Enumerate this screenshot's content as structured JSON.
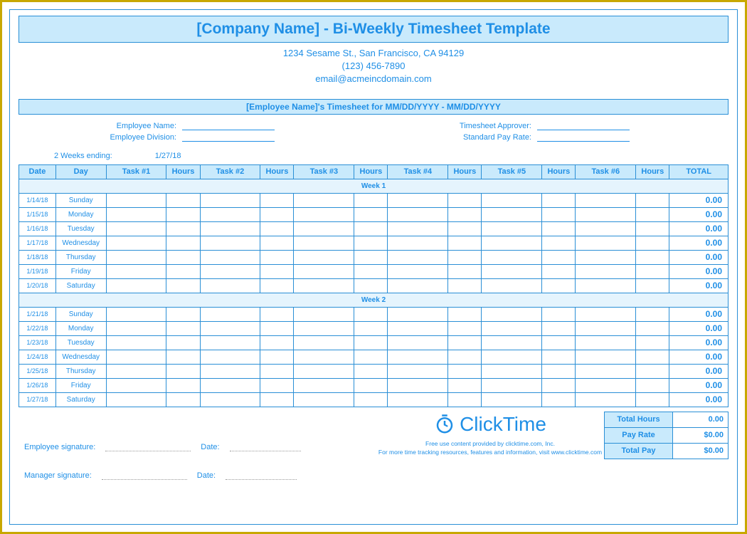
{
  "title": "[Company Name] - Bi-Weekly Timesheet Template",
  "addr": "1234 Sesame St.,   San Francisco, CA 94129",
  "phone": "(123) 456-7890",
  "email": "email@acmeincdomain.com",
  "subhdr": "[Employee Name]'s Timesheet for MM/DD/YYYY - MM/DD/YYYY",
  "labels": {
    "empName": "Employee Name:",
    "empDiv": "Employee Division:",
    "approver": "Timesheet Approver:",
    "payRate": "Standard Pay Rate:",
    "ending": "2 Weeks ending:",
    "endDate": "1/27/18",
    "empSig": "Employee signature:",
    "mgrSig": "Manager signature:",
    "date": "Date:"
  },
  "cols": [
    "Date",
    "Day",
    "Task #1",
    "Hours",
    "Task #2",
    "Hours",
    "Task #3",
    "Hours",
    "Task #4",
    "Hours",
    "Task #5",
    "Hours",
    "Task #6",
    "Hours",
    "TOTAL"
  ],
  "wk1": "Week 1",
  "wk2": "Week 2",
  "rows1": [
    {
      "date": "1/14/18",
      "day": "Sunday",
      "tot": "0.00"
    },
    {
      "date": "1/15/18",
      "day": "Monday",
      "tot": "0.00"
    },
    {
      "date": "1/16/18",
      "day": "Tuesday",
      "tot": "0.00"
    },
    {
      "date": "1/17/18",
      "day": "Wednesday",
      "tot": "0.00"
    },
    {
      "date": "1/18/18",
      "day": "Thursday",
      "tot": "0.00"
    },
    {
      "date": "1/19/18",
      "day": "Friday",
      "tot": "0.00"
    },
    {
      "date": "1/20/18",
      "day": "Saturday",
      "tot": "0.00"
    }
  ],
  "rows2": [
    {
      "date": "1/21/18",
      "day": "Sunday",
      "tot": "0.00"
    },
    {
      "date": "1/22/18",
      "day": "Monday",
      "tot": "0.00"
    },
    {
      "date": "1/23/18",
      "day": "Tuesday",
      "tot": "0.00"
    },
    {
      "date": "1/24/18",
      "day": "Wednesday",
      "tot": "0.00"
    },
    {
      "date": "1/25/18",
      "day": "Thursday",
      "tot": "0.00"
    },
    {
      "date": "1/26/18",
      "day": "Friday",
      "tot": "0.00"
    },
    {
      "date": "1/27/18",
      "day": "Saturday",
      "tot": "0.00"
    }
  ],
  "sum": {
    "thLab": "Total Hours",
    "th": "0.00",
    "prLab": "Pay Rate",
    "pr": "$0.00",
    "tpLab": "Total Pay",
    "tp": "$0.00"
  },
  "brand": {
    "name": "ClickTime",
    "l1": "Free use content provided by clicktime.com, Inc.",
    "l2": "For more time tracking resources, features and information, visit www.clicktime.com"
  }
}
